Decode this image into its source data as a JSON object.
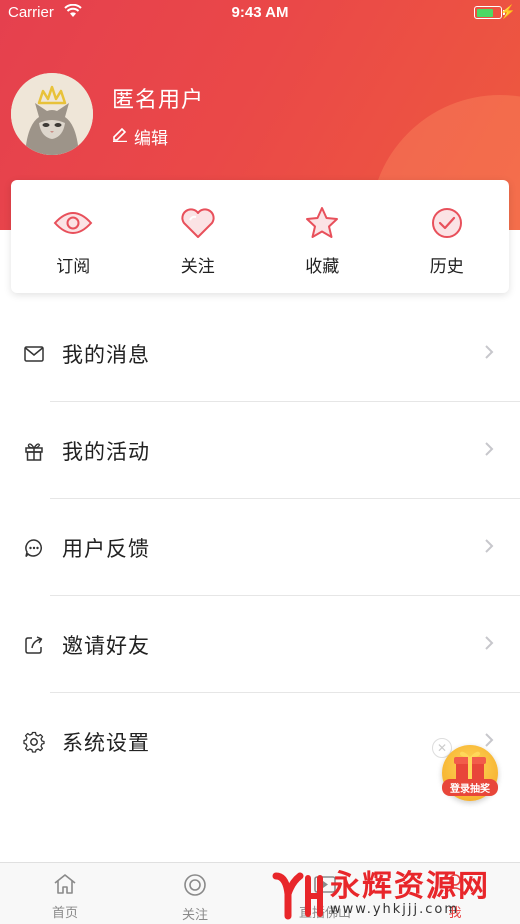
{
  "status_bar": {
    "carrier": "Carrier",
    "time": "9:43 AM",
    "battery_level": 0.7
  },
  "profile": {
    "username": "匿名用户",
    "edit_label": "编辑"
  },
  "quick_actions": [
    {
      "label": "订阅",
      "icon": "eye-icon"
    },
    {
      "label": "关注",
      "icon": "heart-icon"
    },
    {
      "label": "收藏",
      "icon": "star-icon"
    },
    {
      "label": "历史",
      "icon": "check-circle-icon"
    }
  ],
  "menu": [
    {
      "label": "我的消息",
      "icon": "mail-icon"
    },
    {
      "label": "我的活动",
      "icon": "gift-icon"
    },
    {
      "label": "用户反馈",
      "icon": "chat-icon"
    },
    {
      "label": "邀请好友",
      "icon": "share-icon"
    },
    {
      "label": "系统设置",
      "icon": "gear-icon"
    }
  ],
  "promo": {
    "label": "登录抽奖"
  },
  "tabbar": [
    {
      "label": "首页",
      "icon": "home-icon",
      "active": false
    },
    {
      "label": "关注",
      "icon": "target-icon",
      "active": false
    },
    {
      "label": "直播佛山",
      "icon": "live-icon",
      "active": false
    },
    {
      "label": "我",
      "icon": "user-icon",
      "active": true
    }
  ],
  "watermark": {
    "title": "永辉资源网",
    "url": "www.yhkjjj.com"
  },
  "colors": {
    "accent": "#e84040",
    "header_start": "#e5404e",
    "header_end": "#ee5a3e"
  }
}
